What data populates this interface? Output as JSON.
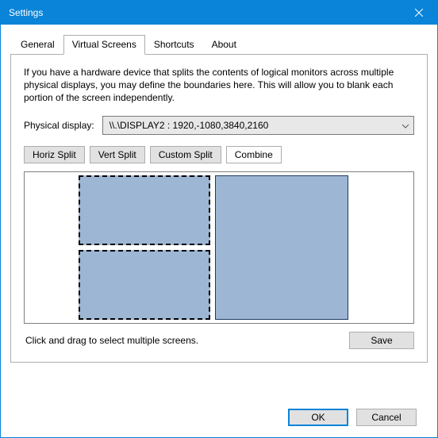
{
  "title": "Settings",
  "tabs": {
    "general": "General",
    "virtual_screens": "Virtual Screens",
    "shortcuts": "Shortcuts",
    "about": "About"
  },
  "intro": "If you have a hardware device that splits the contents of logical monitors across multiple physical displays, you may define the boundaries here. This will allow you to blank each portion of the screen independently.",
  "display_label": "Physical display:",
  "display_value": "\\\\.\\DISPLAY2 : 1920,-1080,3840,2160",
  "buttons": {
    "horiz": "Horiz Split",
    "vert": "Vert Split",
    "custom": "Custom Split",
    "combine": "Combine"
  },
  "hint": "Click and drag to select multiple screens.",
  "save": "Save",
  "ok": "OK",
  "cancel": "Cancel"
}
